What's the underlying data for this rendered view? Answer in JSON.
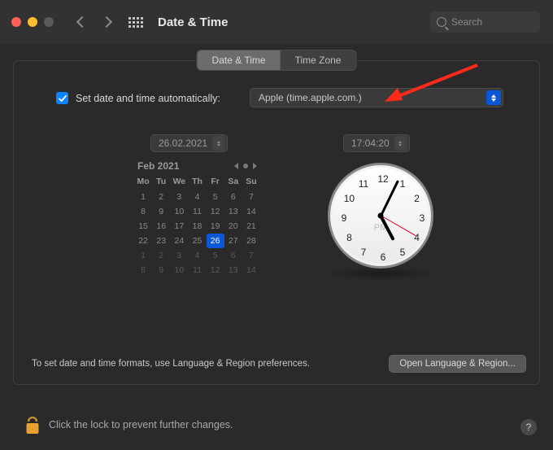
{
  "titlebar": {
    "title": "Date & Time",
    "search_placeholder": "Search"
  },
  "tabs": {
    "date_time": "Date & Time",
    "time_zone": "Time Zone"
  },
  "auto": {
    "label": "Set date and time automatically:",
    "server": "Apple (time.apple.com.)",
    "checked": true
  },
  "date_field": "26.02.2021",
  "time_field": "17:04:20",
  "calendar": {
    "month_label": "Feb 2021",
    "dow": [
      "Mo",
      "Tu",
      "We",
      "Th",
      "Fr",
      "Sa",
      "Su"
    ],
    "weeks": [
      [
        1,
        2,
        3,
        4,
        5,
        6,
        7
      ],
      [
        8,
        9,
        10,
        11,
        12,
        13,
        14
      ],
      [
        15,
        16,
        17,
        18,
        19,
        20,
        21
      ],
      [
        22,
        23,
        24,
        25,
        26,
        27,
        28
      ],
      [
        1,
        2,
        3,
        4,
        5,
        6,
        7
      ],
      [
        8,
        9,
        10,
        11,
        12,
        13,
        14
      ]
    ],
    "selected_day": 26,
    "dim_rows_from": 4
  },
  "clock": {
    "ampm": "PM",
    "hours": 5,
    "minutes": 4,
    "seconds": 20
  },
  "footer": {
    "hint": "To set date and time formats, use Language & Region preferences.",
    "open_button": "Open Language & Region..."
  },
  "lock": {
    "text": "Click the lock to prevent further changes."
  },
  "help_glyph": "?"
}
